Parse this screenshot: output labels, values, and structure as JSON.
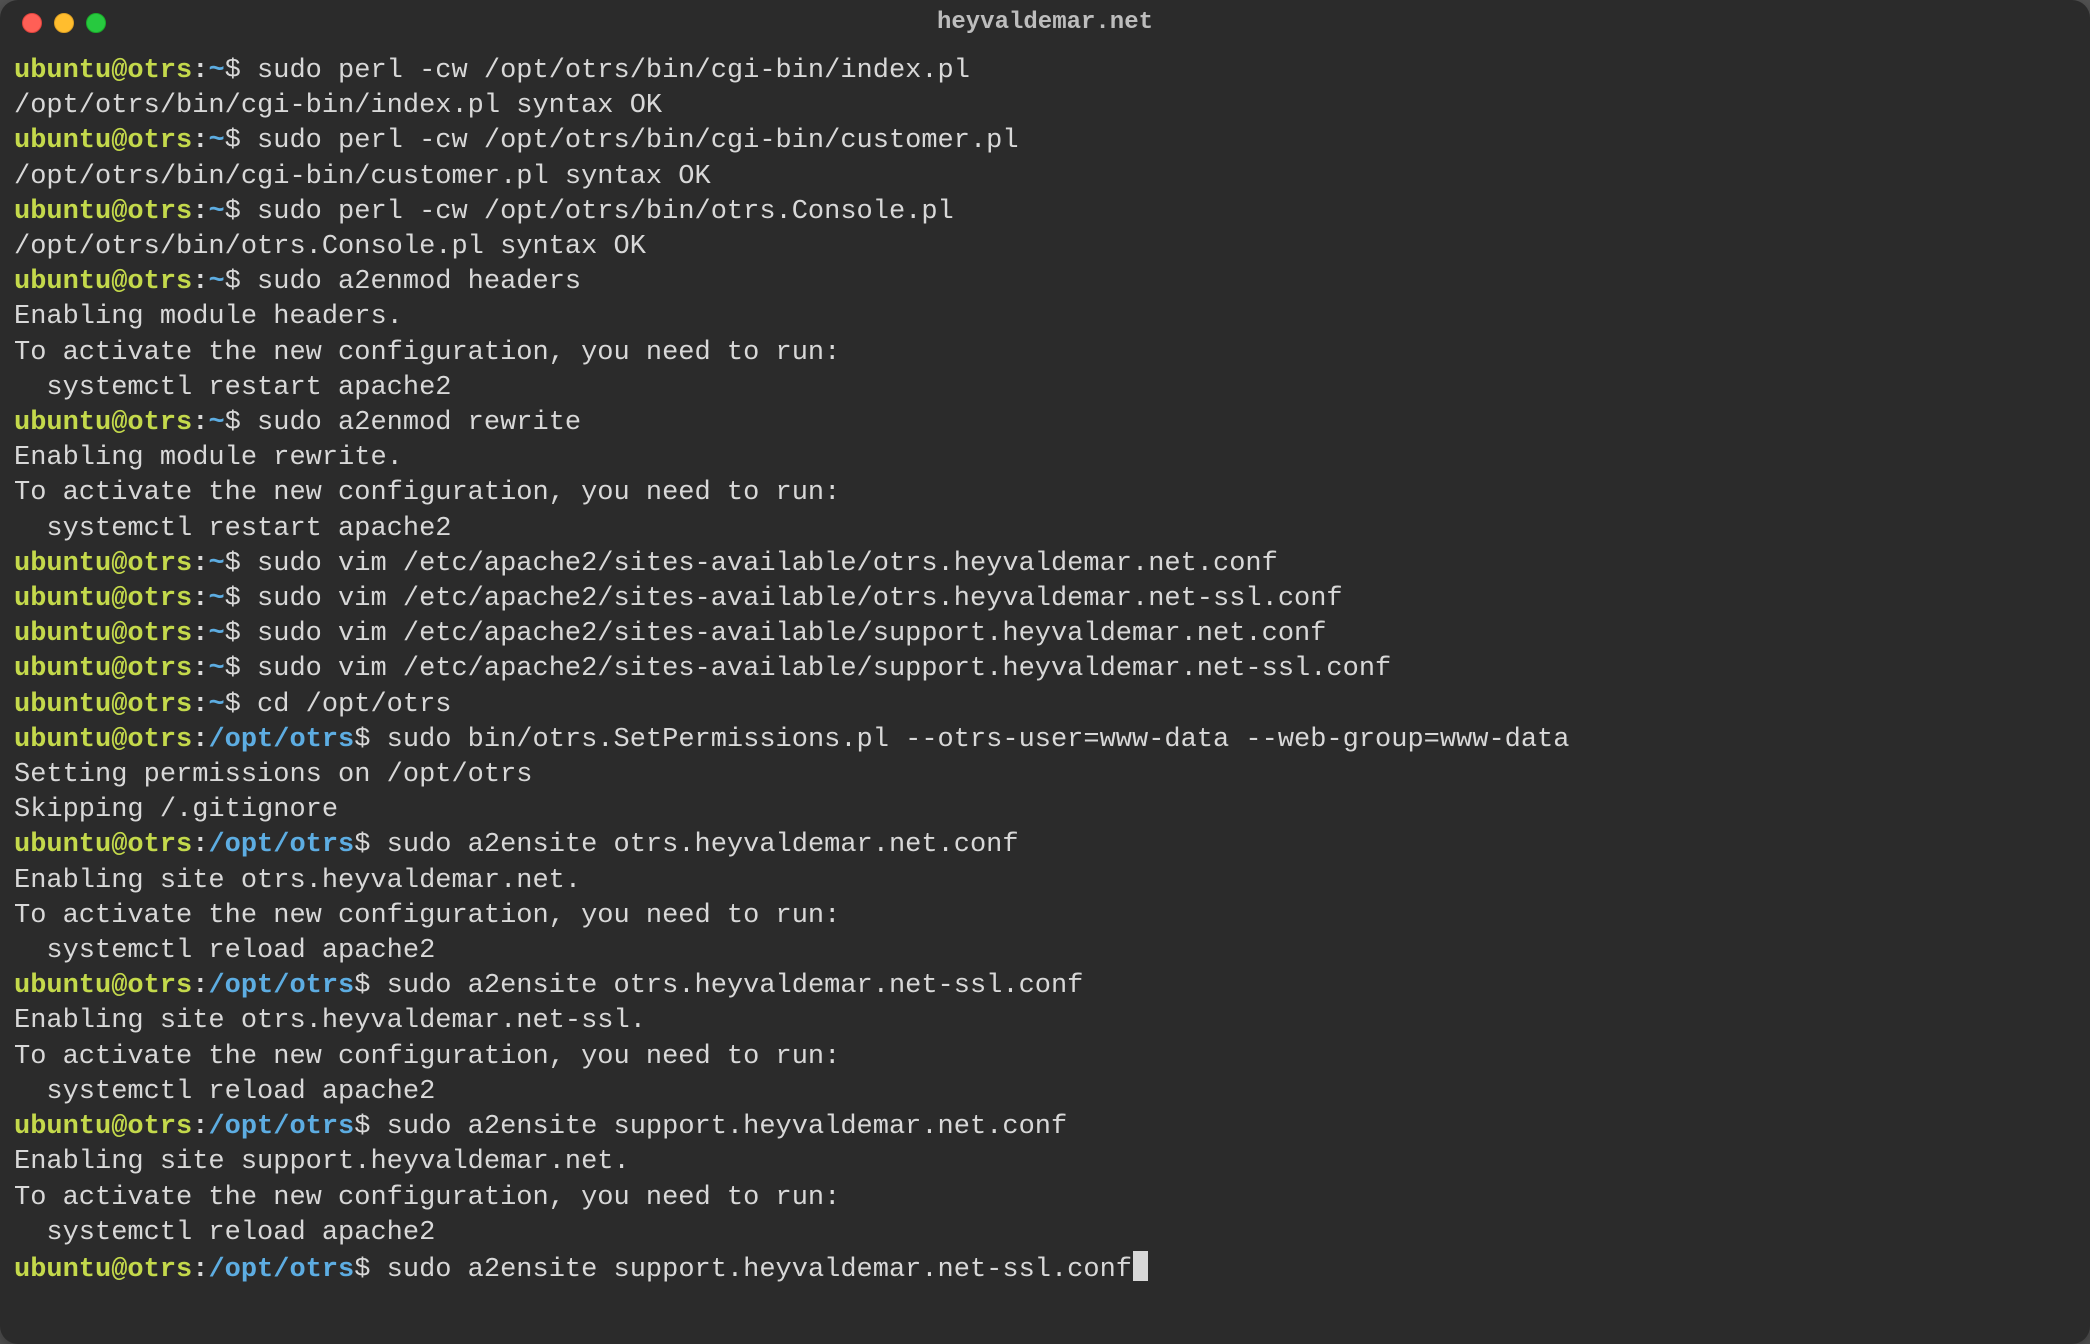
{
  "window": {
    "title": "heyvaldemar.net"
  },
  "prompt": {
    "user_host": "ubuntu@otrs",
    "home": "~",
    "path": "/opt/otrs",
    "symbol": "$"
  },
  "lines": [
    {
      "type": "prompt_home",
      "cmd": "sudo perl -cw /opt/otrs/bin/cgi-bin/index.pl"
    },
    {
      "type": "output",
      "text": "/opt/otrs/bin/cgi-bin/index.pl syntax OK"
    },
    {
      "type": "prompt_home",
      "cmd": "sudo perl -cw /opt/otrs/bin/cgi-bin/customer.pl"
    },
    {
      "type": "output",
      "text": "/opt/otrs/bin/cgi-bin/customer.pl syntax OK"
    },
    {
      "type": "prompt_home",
      "cmd": "sudo perl -cw /opt/otrs/bin/otrs.Console.pl"
    },
    {
      "type": "output",
      "text": "/opt/otrs/bin/otrs.Console.pl syntax OK"
    },
    {
      "type": "prompt_home",
      "cmd": "sudo a2enmod headers"
    },
    {
      "type": "output",
      "text": "Enabling module headers."
    },
    {
      "type": "output",
      "text": "To activate the new configuration, you need to run:"
    },
    {
      "type": "output",
      "text": "  systemctl restart apache2"
    },
    {
      "type": "prompt_home",
      "cmd": "sudo a2enmod rewrite"
    },
    {
      "type": "output",
      "text": "Enabling module rewrite."
    },
    {
      "type": "output",
      "text": "To activate the new configuration, you need to run:"
    },
    {
      "type": "output",
      "text": "  systemctl restart apache2"
    },
    {
      "type": "prompt_home",
      "cmd": "sudo vim /etc/apache2/sites-available/otrs.heyvaldemar.net.conf"
    },
    {
      "type": "prompt_home",
      "cmd": "sudo vim /etc/apache2/sites-available/otrs.heyvaldemar.net-ssl.conf"
    },
    {
      "type": "prompt_home",
      "cmd": "sudo vim /etc/apache2/sites-available/support.heyvaldemar.net.conf"
    },
    {
      "type": "prompt_home",
      "cmd": "sudo vim /etc/apache2/sites-available/support.heyvaldemar.net-ssl.conf"
    },
    {
      "type": "prompt_home",
      "cmd": "cd /opt/otrs"
    },
    {
      "type": "prompt_path",
      "cmd": "sudo bin/otrs.SetPermissions.pl --otrs-user=www-data --web-group=www-data"
    },
    {
      "type": "output",
      "text": "Setting permissions on /opt/otrs"
    },
    {
      "type": "output",
      "text": "Skipping /.gitignore"
    },
    {
      "type": "prompt_path",
      "cmd": "sudo a2ensite otrs.heyvaldemar.net.conf"
    },
    {
      "type": "output",
      "text": "Enabling site otrs.heyvaldemar.net."
    },
    {
      "type": "output",
      "text": "To activate the new configuration, you need to run:"
    },
    {
      "type": "output",
      "text": "  systemctl reload apache2"
    },
    {
      "type": "prompt_path",
      "cmd": "sudo a2ensite otrs.heyvaldemar.net-ssl.conf"
    },
    {
      "type": "output",
      "text": "Enabling site otrs.heyvaldemar.net-ssl."
    },
    {
      "type": "output",
      "text": "To activate the new configuration, you need to run:"
    },
    {
      "type": "output",
      "text": "  systemctl reload apache2"
    },
    {
      "type": "prompt_path",
      "cmd": "sudo a2ensite support.heyvaldemar.net.conf"
    },
    {
      "type": "output",
      "text": "Enabling site support.heyvaldemar.net."
    },
    {
      "type": "output",
      "text": "To activate the new configuration, you need to run:"
    },
    {
      "type": "output",
      "text": "  systemctl reload apache2"
    },
    {
      "type": "prompt_path_cursor",
      "cmd": "sudo a2ensite support.heyvaldemar.net-ssl.conf"
    }
  ]
}
